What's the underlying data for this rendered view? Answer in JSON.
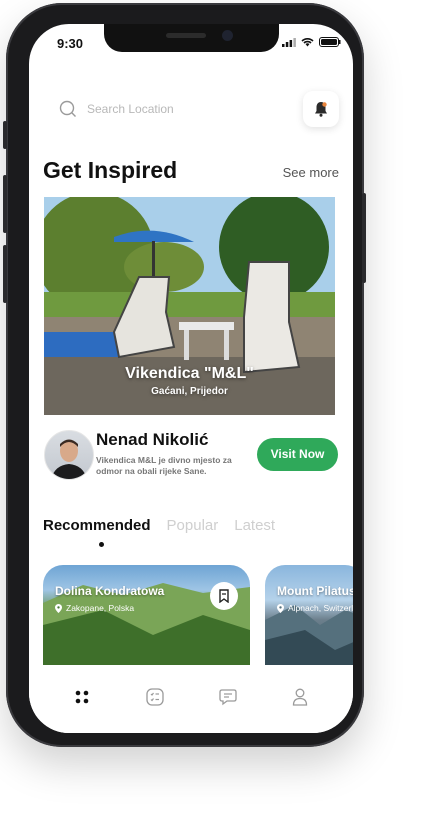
{
  "status": {
    "time": "9:30"
  },
  "search": {
    "placeholder": "Search Location"
  },
  "inspired": {
    "title": "Get Inspired",
    "see_more": "See more"
  },
  "featured": {
    "title": "Vikendica \"M&L\"",
    "location": "Gaćani, Prijedor"
  },
  "author": {
    "name": "Nenad Nikolić",
    "description": "Vikendica M&L je divno mjesto za odmor na obali rijeke Sane.",
    "cta": "Visit Now"
  },
  "tabs": [
    {
      "label": "Recommended",
      "active": true
    },
    {
      "label": "Popular",
      "active": false
    },
    {
      "label": "Latest",
      "active": false
    }
  ],
  "cards": [
    {
      "title": "Dolina Kondratowa",
      "location": "Zakopane, Polska"
    },
    {
      "title": "Mount Pilatus",
      "location": "Alpnach, Switzerland"
    }
  ],
  "nav": [
    "grid-icon",
    "checklist-icon",
    "chat-icon",
    "profile-icon"
  ],
  "colors": {
    "accent": "#2fa95a",
    "frame": "#1b1b1d"
  }
}
